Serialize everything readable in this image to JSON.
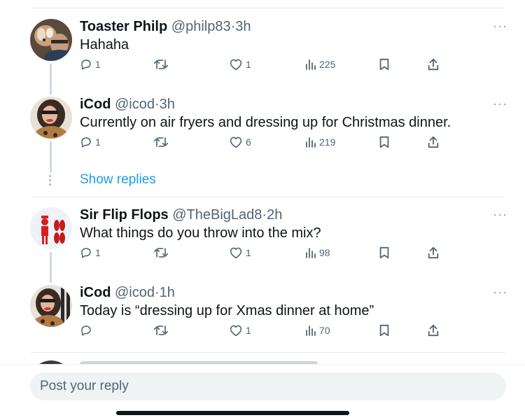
{
  "tweets": [
    {
      "name": "Toaster Philp",
      "handle": "@philp83",
      "time": "3h",
      "text": "Hahaha",
      "reply_count": "1",
      "like_count": "1",
      "view_count": "225",
      "avatar": "dog-and-man-photo"
    },
    {
      "name": "iCod",
      "handle": "@icod",
      "time": "3h",
      "text": "Currently on air fryers and dressing up for Christmas dinner.",
      "reply_count": "1",
      "like_count": "6",
      "view_count": "219",
      "avatar": "woman-glasses-photo"
    },
    {
      "name": "Sir Flip Flops",
      "handle": "@TheBigLad8",
      "time": "2h",
      "text": "What things do you throw into the mix?",
      "reply_count": "1",
      "like_count": "1",
      "view_count": "98",
      "avatar": "red-figure-flip-flops-illustration"
    },
    {
      "name": "iCod",
      "handle": "@icod",
      "time": "1h",
      "text": "Today is “dressing up for Xmas dinner at home”",
      "reply_count": "",
      "like_count": "1",
      "view_count": "70",
      "avatar": "woman-glasses-photo"
    }
  ],
  "show_replies_label": "Show replies",
  "separator": "·",
  "more_glyph": "···",
  "reply_bar": {
    "placeholder": "Post your reply"
  },
  "colors": {
    "link": "#1d9bf0",
    "secondary_text": "#536471",
    "primary_text": "#0f1419",
    "thread_line": "#cfd9de",
    "input_bg": "#eff3f4"
  },
  "icons": [
    "reply-icon",
    "retweet-icon",
    "like-icon",
    "views-icon",
    "bookmark-icon",
    "share-icon",
    "more-icon"
  ]
}
